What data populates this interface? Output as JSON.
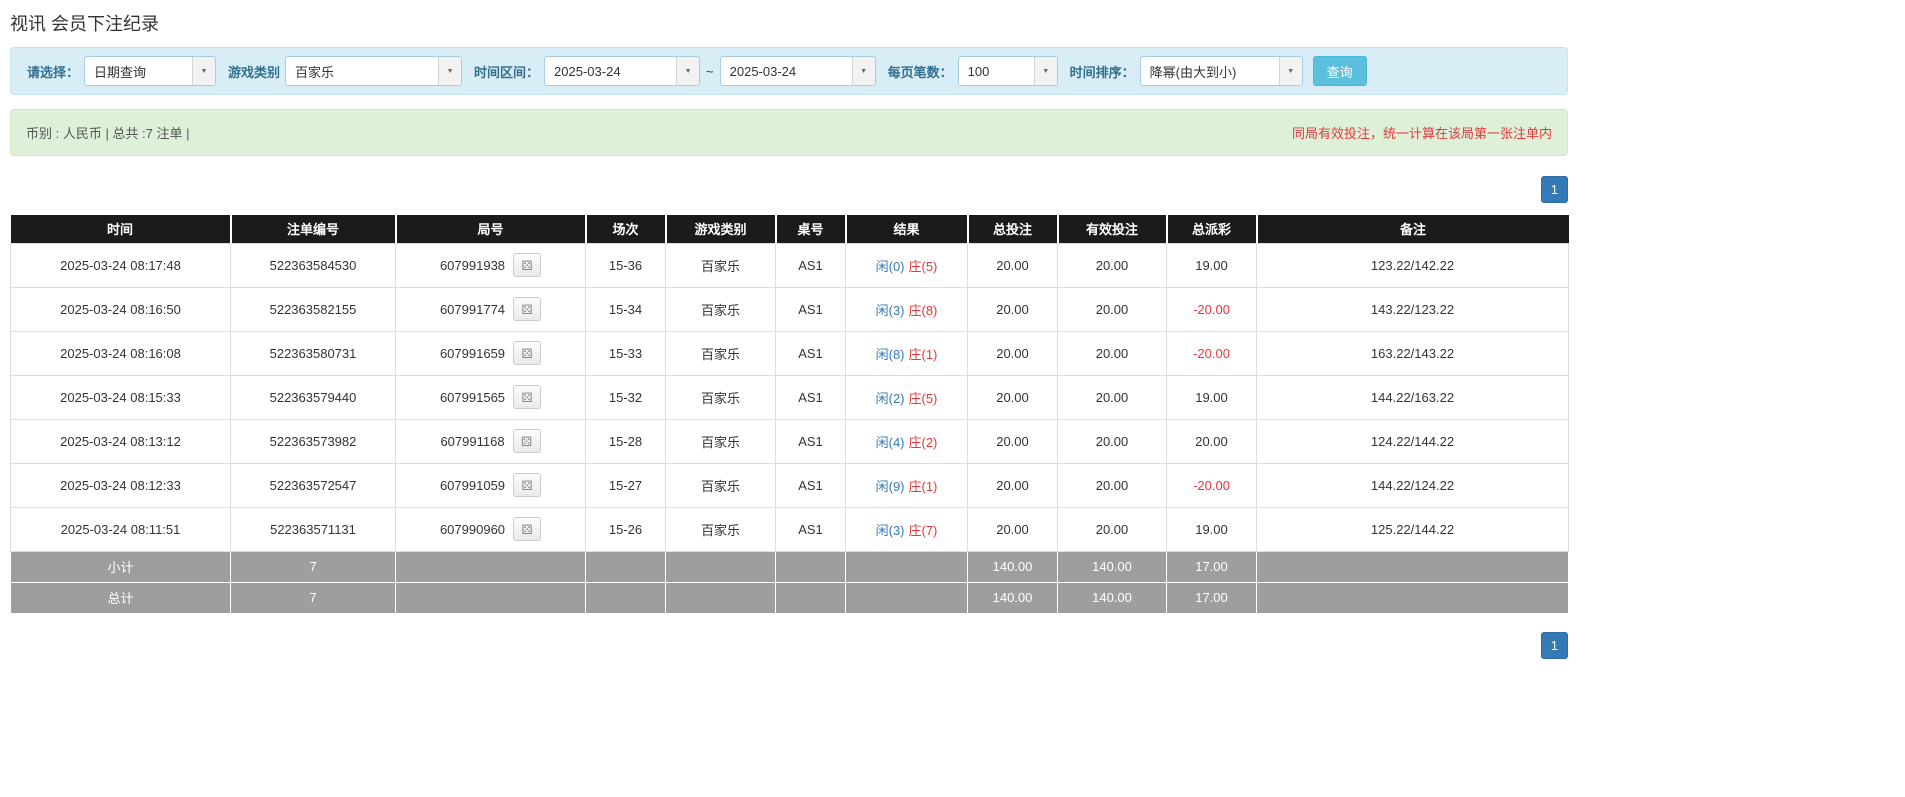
{
  "page": {
    "title": "视讯 会员下注纪录"
  },
  "filters": {
    "query_type": {
      "label": "请选择：",
      "value": "日期查询"
    },
    "game_type": {
      "label": "游戏类别",
      "value": "百家乐"
    },
    "date_range": {
      "label": "时间区间：",
      "from": "2025-03-24",
      "separator": "~",
      "to": "2025-03-24"
    },
    "page_size": {
      "label": "每页笔数：",
      "value": "100"
    },
    "sort": {
      "label": "时间排序：",
      "value": "降幂(由大到小)"
    },
    "query_button_label": "查询"
  },
  "summary_bar": {
    "left_text": "币别 : 人民币 | 总共 :7 注单 |",
    "right_notice": "同局有效投注，统一计算在该局第一张注单内"
  },
  "pagination": {
    "current_page": "1"
  },
  "icons": {
    "dropdown_caret": "▼",
    "round_detail": "⚄"
  },
  "colors": {
    "accent_blue": "#337ab7",
    "negative_red": "#e4393c",
    "player_blue": "#337ab7",
    "banker_red": "#e4393c",
    "query_button_bg": "#5bc0de",
    "filter_bar_bg": "#d9edf7",
    "summary_bar_bg": "#dff0d8",
    "table_header_bg": "#1b1b1b",
    "summary_row_bg": "#9e9e9e"
  },
  "table": {
    "headers": [
      "时间",
      "注单编号",
      "局号",
      "场次",
      "游戏类别",
      "桌号",
      "结果",
      "总投注",
      "有效投注",
      "总派彩",
      "备注"
    ],
    "rows": [
      {
        "time": "2025-03-24 08:17:48",
        "bet_id": "522363584530",
        "round_id": "607991938",
        "session": "15-36",
        "game": "百家乐",
        "table_no": "AS1",
        "result_player": "闲(0)",
        "result_banker": "庄(5)",
        "total_bet": "20.00",
        "valid_bet": "20.00",
        "payout": "19.00",
        "remark": "123.22/142.22"
      },
      {
        "time": "2025-03-24 08:16:50",
        "bet_id": "522363582155",
        "round_id": "607991774",
        "session": "15-34",
        "game": "百家乐",
        "table_no": "AS1",
        "result_player": "闲(3)",
        "result_banker": "庄(8)",
        "total_bet": "20.00",
        "valid_bet": "20.00",
        "payout": "-20.00",
        "remark": "143.22/123.22"
      },
      {
        "time": "2025-03-24 08:16:08",
        "bet_id": "522363580731",
        "round_id": "607991659",
        "session": "15-33",
        "game": "百家乐",
        "table_no": "AS1",
        "result_player": "闲(8)",
        "result_banker": "庄(1)",
        "total_bet": "20.00",
        "valid_bet": "20.00",
        "payout": "-20.00",
        "remark": "163.22/143.22"
      },
      {
        "time": "2025-03-24 08:15:33",
        "bet_id": "522363579440",
        "round_id": "607991565",
        "session": "15-32",
        "game": "百家乐",
        "table_no": "AS1",
        "result_player": "闲(2)",
        "result_banker": "庄(5)",
        "total_bet": "20.00",
        "valid_bet": "20.00",
        "payout": "19.00",
        "remark": "144.22/163.22"
      },
      {
        "time": "2025-03-24 08:13:12",
        "bet_id": "522363573982",
        "round_id": "607991168",
        "session": "15-28",
        "game": "百家乐",
        "table_no": "AS1",
        "result_player": "闲(4)",
        "result_banker": "庄(2)",
        "total_bet": "20.00",
        "valid_bet": "20.00",
        "payout": "20.00",
        "remark": "124.22/144.22"
      },
      {
        "time": "2025-03-24 08:12:33",
        "bet_id": "522363572547",
        "round_id": "607991059",
        "session": "15-27",
        "game": "百家乐",
        "table_no": "AS1",
        "result_player": "闲(9)",
        "result_banker": "庄(1)",
        "total_bet": "20.00",
        "valid_bet": "20.00",
        "payout": "-20.00",
        "remark": "144.22/124.22"
      },
      {
        "time": "2025-03-24 08:11:51",
        "bet_id": "522363571131",
        "round_id": "607990960",
        "session": "15-26",
        "game": "百家乐",
        "table_no": "AS1",
        "result_player": "闲(3)",
        "result_banker": "庄(7)",
        "total_bet": "20.00",
        "valid_bet": "20.00",
        "payout": "19.00",
        "remark": "125.22/144.22"
      }
    ],
    "subtotal": {
      "label": "小计",
      "count": "7",
      "total_bet": "140.00",
      "valid_bet": "140.00",
      "payout": "17.00"
    },
    "grand_total": {
      "label": "总计",
      "count": "7",
      "total_bet": "140.00",
      "valid_bet": "140.00",
      "payout": "17.00"
    }
  }
}
